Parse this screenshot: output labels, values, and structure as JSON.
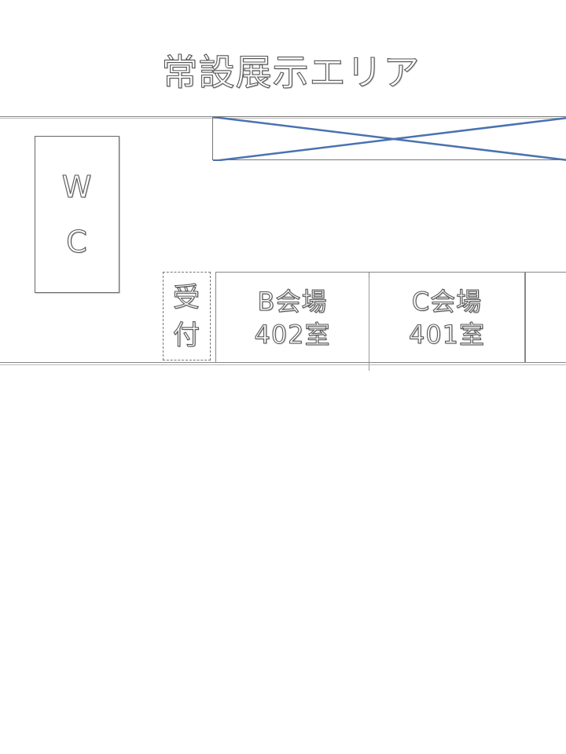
{
  "title": "常設展示エリア",
  "wc": {
    "line1": "W",
    "line2": "C"
  },
  "reception": {
    "line1": "受",
    "line2": "付"
  },
  "rooms": [
    {
      "name": "B会場",
      "number": "402室"
    },
    {
      "name": "C会場",
      "number": "401室"
    }
  ],
  "colors": {
    "cross": "#4a72b0",
    "outline": "#555555",
    "lines": "#888888"
  }
}
